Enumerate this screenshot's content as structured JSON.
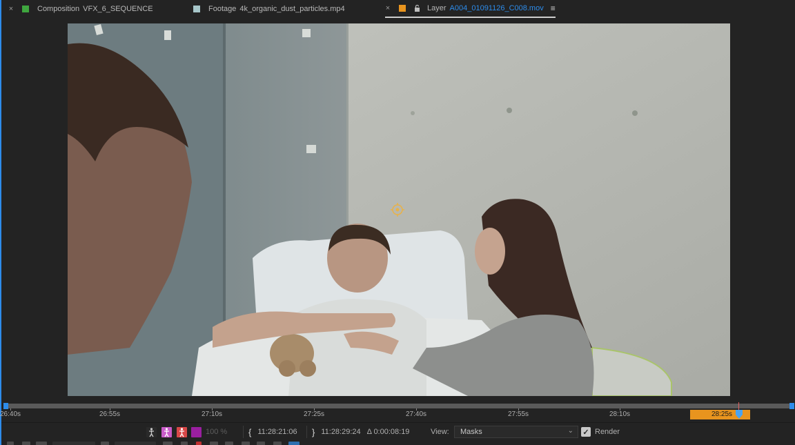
{
  "tabs": [
    {
      "close": "×",
      "label": "Composition",
      "name": "VFX_6_SEQUENCE",
      "color": "#3fa63f"
    },
    {
      "close": "×",
      "label": "Footage",
      "name": "4k_organic_dust_particles.mp4",
      "color": "#a6c6c9"
    },
    {
      "close": "×",
      "label": "Layer",
      "name": "A004_01091126_C008.mov",
      "color": "#e8941e",
      "active": true,
      "menu": "≡"
    }
  ],
  "timeline": {
    "ticks": [
      "26:40s",
      "26:55s",
      "27:10s",
      "27:25s",
      "27:40s",
      "27:55s",
      "28:10s"
    ],
    "current": "28:25s",
    "work_area_color": "#e8941e"
  },
  "controls": {
    "opacity": "100 %",
    "in_point": "11:28:21:06",
    "out_point": "11:28:29:24",
    "duration": "Δ 0:00:08:19",
    "view_label": "View:",
    "view_value": "Masks",
    "render_label": "Render",
    "render_checked": "✓"
  },
  "colors": {
    "accent": "#2d8ceb",
    "work_area": "#e8941e",
    "background": "#232323"
  }
}
